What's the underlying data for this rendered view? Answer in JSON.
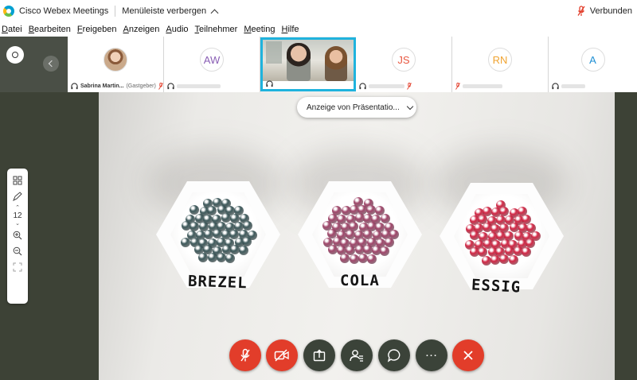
{
  "titlebar": {
    "app_title": "Cisco Webex Meetings",
    "hide_menu_label": "Menüleiste verbergen",
    "connection_status": "Verbunden"
  },
  "menu": {
    "items": [
      {
        "label": "Datei",
        "accel": "D",
        "rest": "atei"
      },
      {
        "label": "Bearbeiten",
        "accel": "B",
        "rest": "earbeiten"
      },
      {
        "label": "Freigeben",
        "accel": "F",
        "rest": "reigeben"
      },
      {
        "label": "Anzeigen",
        "accel": "A",
        "rest": "nzeigen"
      },
      {
        "label": "Audio",
        "accel": "A",
        "rest": "udio"
      },
      {
        "label": "Teilnehmer",
        "accel": "T",
        "rest": "eilnehmer"
      },
      {
        "label": "Meeting",
        "accel": "M",
        "rest": "eeting"
      },
      {
        "label": "Hilfe",
        "accel": "H",
        "rest": "ilfe"
      }
    ]
  },
  "participants": [
    {
      "name": "Sabrina Martin...",
      "role": "(Gastgeber)",
      "avatar": "photo",
      "muted": true
    },
    {
      "initials": "AW",
      "color": "#8a5fb5",
      "muted": false
    },
    {
      "avatar": "video",
      "active": true,
      "muted": false
    },
    {
      "initials": "JS",
      "color": "#e8563f",
      "muted": true
    },
    {
      "initials": "RN",
      "color": "#f0a330",
      "muted": true
    },
    {
      "initials": "A",
      "color": "#1f8fd4",
      "muted": false
    }
  ],
  "presentation": {
    "dropdown_label": "Anzeige von Präsentatio...",
    "labels": [
      "BREZEL",
      "COLA",
      "ESSIG"
    ],
    "colors": {
      "brezel": "#3f5a5c",
      "cola": "#a0476b",
      "essig": "#d22846"
    }
  },
  "annotation": {
    "zoom": "12",
    "icons": [
      "grid-icon",
      "pen-icon",
      "zoom-in-icon",
      "zoom-out-icon",
      "fit-icon"
    ]
  },
  "controls": [
    {
      "name": "mute-button",
      "icon": "mic-off-icon",
      "color": "#e23d2a"
    },
    {
      "name": "video-button",
      "icon": "camera-off-icon",
      "color": "#e23d2a"
    },
    {
      "name": "share-button",
      "icon": "share-icon",
      "color": "#3b4339"
    },
    {
      "name": "participants-button",
      "icon": "participants-icon",
      "color": "#3b4339"
    },
    {
      "name": "chat-button",
      "icon": "chat-icon",
      "color": "#3b4339"
    },
    {
      "name": "more-button",
      "icon": "more-icon",
      "color": "#3b4339"
    },
    {
      "name": "leave-button",
      "icon": "close-icon",
      "color": "#e23d2a"
    }
  ]
}
